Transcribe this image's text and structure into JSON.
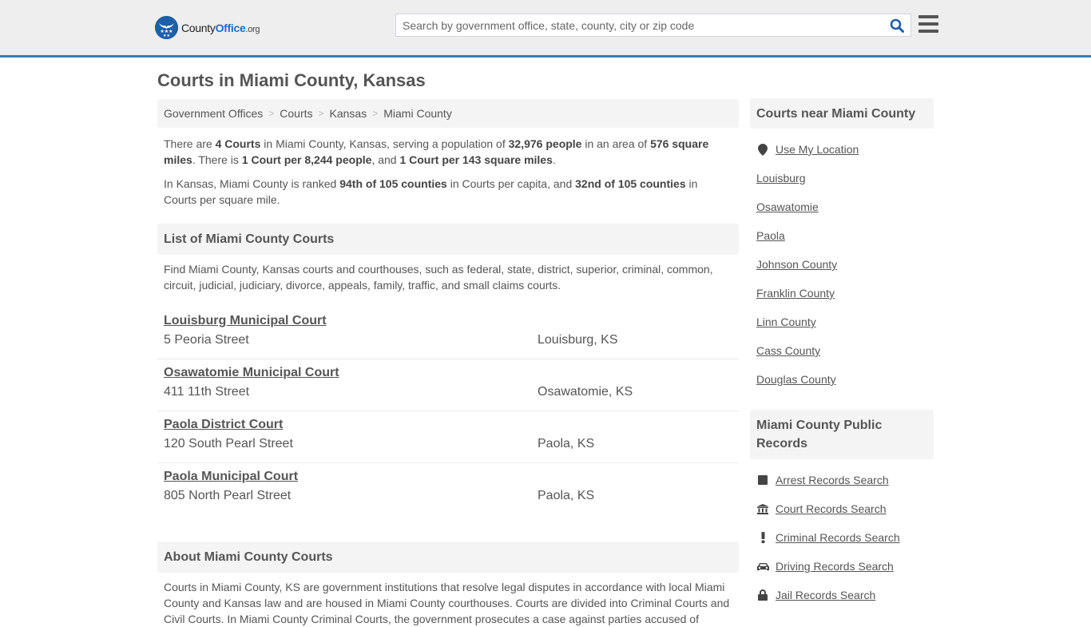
{
  "header": {
    "logo": {
      "county": "County",
      "office": "Office",
      "org": ".org"
    },
    "search_placeholder": "Search by government office, state, county, city or zip code",
    "accent_color": "#3a7db5",
    "brand_color": "#1d6fc1"
  },
  "page_title": "Courts in Miami County, Kansas",
  "breadcrumb": [
    {
      "label": "Government Offices"
    },
    {
      "label": "Courts"
    },
    {
      "label": "Kansas"
    },
    {
      "label": "Miami County"
    }
  ],
  "intro": {
    "p1": {
      "t1": "There are ",
      "b1": "4 Courts",
      "t2": " in Miami County, Kansas, serving a population of ",
      "b2": "32,976 people",
      "t3": " in an area of ",
      "b3": "576 square miles",
      "t4": ". There is ",
      "b4": "1 Court per 8,244 people",
      "t5": ", and ",
      "b5": "1 Court per 143 square miles",
      "t6": "."
    },
    "p2": {
      "t1": "In Kansas, Miami County is ranked ",
      "b1": "94th of 105 counties",
      "t2": " in Courts per capita, and ",
      "b2": "32nd of 105 counties",
      "t3": " in Courts per square mile."
    }
  },
  "list_section": {
    "title": "List of Miami County Courts",
    "description": "Find Miami County, Kansas courts and courthouses, such as federal, state, district, superior, criminal, common, circuit, judicial, judiciary, divorce, appeals, family, traffic, and small claims courts."
  },
  "courts": [
    {
      "name": "Louisburg Municipal Court",
      "address": "5 Peoria Street",
      "city": "Louisburg, KS"
    },
    {
      "name": "Osawatomie Municipal Court",
      "address": "411 11th Street",
      "city": "Osawatomie, KS"
    },
    {
      "name": "Paola District Court",
      "address": "120 South Pearl Street",
      "city": "Paola, KS"
    },
    {
      "name": "Paola Municipal Court",
      "address": "805 North Pearl Street",
      "city": "Paola, KS"
    }
  ],
  "about_section": {
    "title": "About Miami County Courts",
    "text": "Courts in Miami County, KS are government institutions that resolve legal disputes in accordance with local Miami County and Kansas law and are housed in Miami County courthouses. Courts are divided into Criminal Courts and Civil Courts. In Miami County Criminal Courts, the government prosecutes a case against parties accused of"
  },
  "sidebar": {
    "near_title": "Courts near Miami County",
    "use_location": "Use My Location",
    "near": [
      {
        "label": "Louisburg"
      },
      {
        "label": "Osawatomie"
      },
      {
        "label": "Paola"
      },
      {
        "label": "Johnson County"
      },
      {
        "label": "Franklin County"
      },
      {
        "label": "Linn County"
      },
      {
        "label": "Cass County"
      },
      {
        "label": "Douglas County"
      }
    ],
    "records_title": "Miami County Public Records",
    "records": [
      {
        "label": "Arrest Records Search",
        "icon": "square-icon"
      },
      {
        "label": "Court Records Search",
        "icon": "courthouse-icon"
      },
      {
        "label": "Criminal Records Search",
        "icon": "exclamation-icon"
      },
      {
        "label": "Driving Records Search",
        "icon": "car-icon"
      },
      {
        "label": "Jail Records Search",
        "icon": "lock-icon"
      }
    ]
  }
}
